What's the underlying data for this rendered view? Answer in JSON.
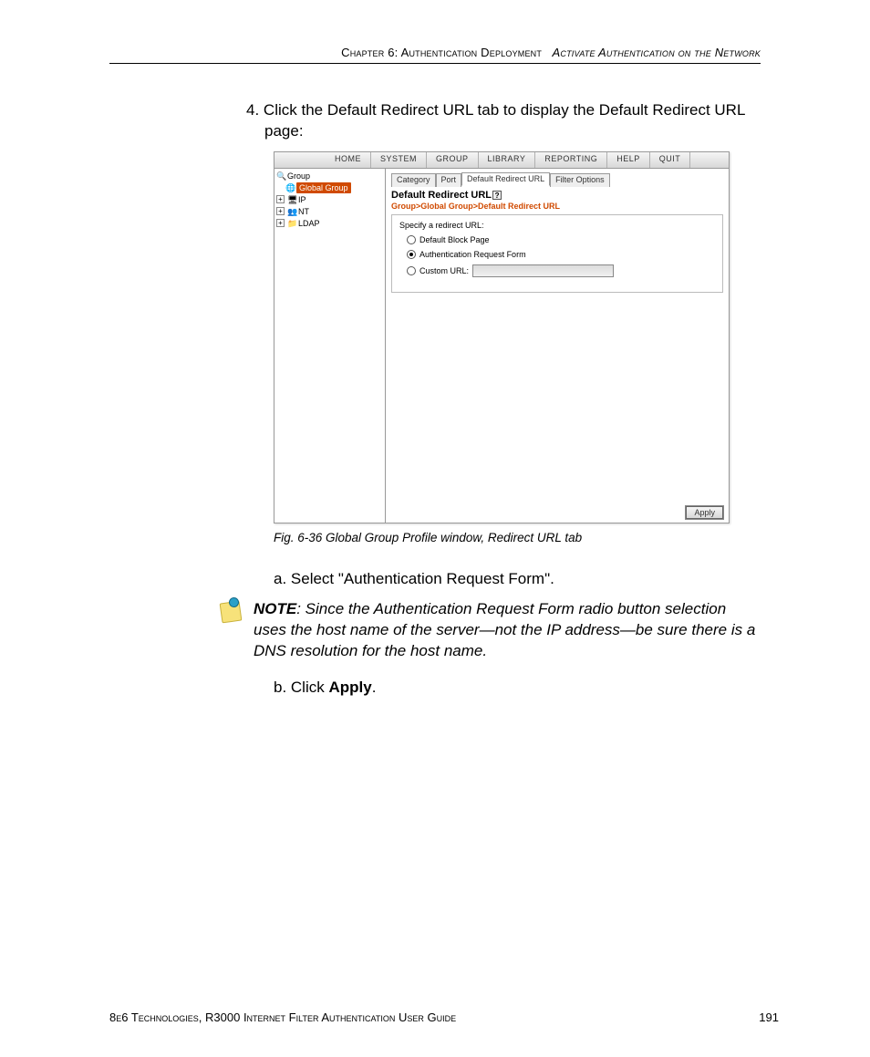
{
  "header": {
    "chapter": "Chapter 6: Authentication Deployment",
    "section": "Activate Authentication on the Network"
  },
  "step4": {
    "number": "4.",
    "text": "Click the Default Redirect URL tab to display the Default Redirect URL page:"
  },
  "screenshot": {
    "menu": {
      "home": "HOME",
      "system": "SYSTEM",
      "group": "GROUP",
      "library": "LIBRARY",
      "reporting": "REPORTING",
      "help": "HELP",
      "quit": "QUIT"
    },
    "tree": {
      "root": "Group",
      "global_group": "Global Group",
      "ip": "IP",
      "nt": "NT",
      "ldap": "LDAP"
    },
    "tabs": {
      "category": "Category",
      "port": "Port",
      "default_redirect_url": "Default Redirect URL",
      "filter_options": "Filter Options"
    },
    "panel": {
      "title": "Default Redirect URL",
      "breadcrumb": "Group>Global Group>Default Redirect URL",
      "form_label": "Specify a redirect URL:",
      "opt_default_block": "Default Block Page",
      "opt_auth_request": "Authentication Request Form",
      "opt_custom_url": "Custom URL:",
      "apply": "Apply"
    }
  },
  "caption": "Fig. 6-36  Global Group Profile window, Redirect URL tab",
  "substep_a": "a. Select \"Authentication Request Form\".",
  "note": {
    "label": "NOTE",
    "text": ": Since the Authentication Request Form radio button selection uses the host name of the server—not the IP address—be sure there is a DNS resolution for the host name."
  },
  "substep_b_prefix": "b. Click ",
  "substep_b_bold": "Apply",
  "substep_b_suffix": ".",
  "footer": {
    "left": "8e6 Technologies, R3000 Internet Filter Authentication User Guide",
    "right": "191"
  }
}
